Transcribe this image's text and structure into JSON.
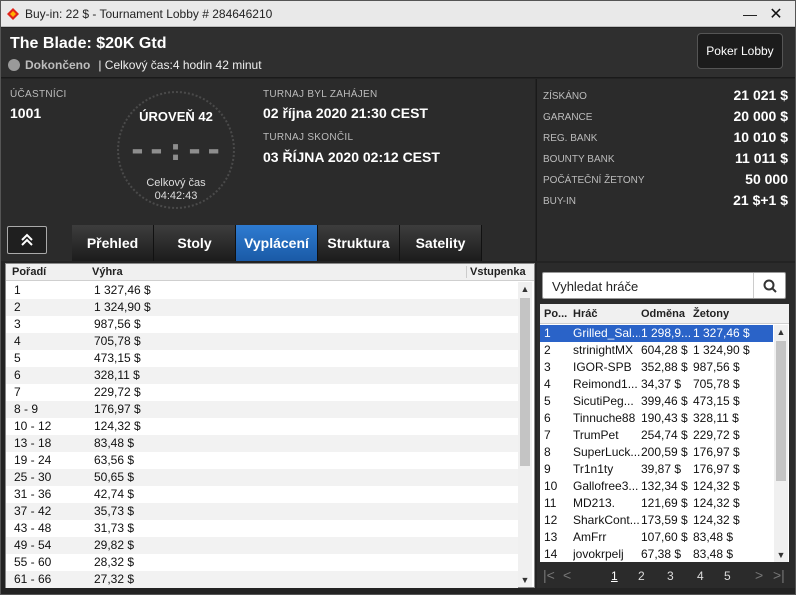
{
  "window": {
    "title": "Buy-in: 22 $ - Tournament Lobby # 284646210",
    "minimize": "—",
    "close": "✕"
  },
  "header": {
    "name": "The Blade: $20K Gtd",
    "status": "Dokončeno",
    "total_time": "| Celkový čas:4 hodin  42 minut",
    "lobby_button": "Poker Lobby"
  },
  "info": {
    "participants_label": "ÚČASTNÍCI",
    "participants": "1001",
    "level": "ÚROVEŇ 42",
    "clock_digits": "--:--",
    "clock_label": "Celkový čas",
    "clock_time": "04:42:43",
    "started_label": "TURNAJ BYL ZAHÁJEN",
    "started": "02 října 2020  21:30 CEST",
    "ended_label": "TURNAJ SKONČIL",
    "ended": "03 ŘÍJNA 2020  02:12 CEST"
  },
  "tabs": [
    "Přehled",
    "Stoly",
    "Vyplácení",
    "Struktura",
    "Satelity"
  ],
  "stats": [
    {
      "label": "ZÍSKÁNO",
      "value": "21 021 $"
    },
    {
      "label": "GARANCE",
      "value": "20 000 $"
    },
    {
      "label": "REG. BANK",
      "value": "10 010 $"
    },
    {
      "label": "BOUNTY BANK",
      "value": "11 011 $"
    },
    {
      "label": "POČÁTEČNÍ ŽETONY",
      "value": "50 000"
    },
    {
      "label": "BUY-IN",
      "value": "21 $+1 $"
    }
  ],
  "payout": {
    "columns": [
      "Pořadí",
      "Výhra",
      "Vstupenka"
    ],
    "rows": [
      [
        "1",
        "1 327,46 $"
      ],
      [
        "2",
        "1 324,90 $"
      ],
      [
        "3",
        "987,56 $"
      ],
      [
        "4",
        "705,78 $"
      ],
      [
        "5",
        "473,15 $"
      ],
      [
        "6",
        "328,11 $"
      ],
      [
        "7",
        "229,72 $"
      ],
      [
        "8 - 9",
        "176,97 $"
      ],
      [
        "10 - 12",
        "124,32 $"
      ],
      [
        "13 - 18",
        "83,48 $"
      ],
      [
        "19 - 24",
        "63,56 $"
      ],
      [
        "25 - 30",
        "50,65 $"
      ],
      [
        "31 - 36",
        "42,74 $"
      ],
      [
        "37 - 42",
        "35,73 $"
      ],
      [
        "43 - 48",
        "31,73 $"
      ],
      [
        "49 - 54",
        "29,82 $"
      ],
      [
        "55 - 60",
        "28,32 $"
      ],
      [
        "61 - 66",
        "27,32 $"
      ]
    ]
  },
  "players": {
    "search_placeholder": "Vyhledat hráče",
    "columns": [
      "Po...",
      "Hráč",
      "Odměna",
      "Žetony"
    ],
    "rows": [
      [
        "1",
        "Grilled_Sal...",
        "1 298,9...",
        "1 327,46 $"
      ],
      [
        "2",
        "strinightMX",
        "604,28 $",
        "1 324,90 $"
      ],
      [
        "3",
        "IGOR-SPB",
        "352,88 $",
        "987,56 $"
      ],
      [
        "4",
        "Reimond1...",
        "34,37 $",
        "705,78 $"
      ],
      [
        "5",
        "SicutiPeg...",
        "399,46 $",
        "473,15 $"
      ],
      [
        "6",
        "Tinnuche88",
        "190,43 $",
        "328,11 $"
      ],
      [
        "7",
        "TrumPet",
        "254,74 $",
        "229,72 $"
      ],
      [
        "8",
        "SuperLuck...",
        "200,59 $",
        "176,97 $"
      ],
      [
        "9",
        "Tr1n1ty",
        "39,87 $",
        "176,97 $"
      ],
      [
        "10",
        "Gallofree3...",
        "132,34 $",
        "124,32 $"
      ],
      [
        "11",
        "MD213.",
        "121,69 $",
        "124,32 $"
      ],
      [
        "12",
        "SharkCont...",
        "173,59 $",
        "124,32 $"
      ],
      [
        "13",
        "AmFrr",
        "107,60 $",
        "83,48 $"
      ],
      [
        "14",
        "jovokrpelj",
        "67,38 $",
        "83,48 $"
      ]
    ],
    "pages": [
      "1",
      "2",
      "3",
      "4",
      "5"
    ]
  }
}
